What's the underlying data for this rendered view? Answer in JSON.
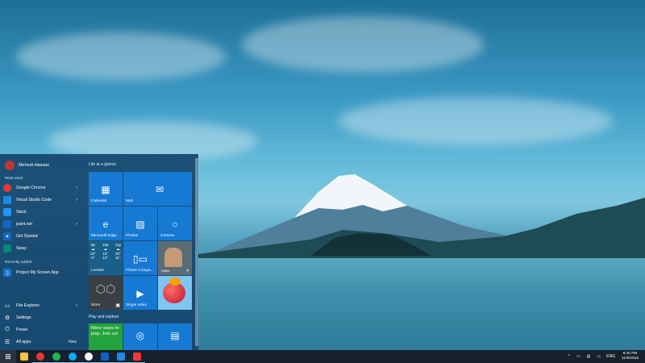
{
  "start_menu": {
    "user_name": "Mehedi Hassan",
    "most_used_label": "Most used",
    "most_used": [
      {
        "label": "Google Chrome",
        "icon": "chrome-icon",
        "color": "#e53935",
        "has_submenu": true
      },
      {
        "label": "Visual Studio Code",
        "icon": "vscode-icon",
        "color": "#1e88e5",
        "has_submenu": true
      },
      {
        "label": "Slack",
        "icon": "slack-icon",
        "color": "#2196f3",
        "has_submenu": false
      },
      {
        "label": "paint.net",
        "icon": "paintnet-icon",
        "color": "#1565c0",
        "has_submenu": true
      },
      {
        "label": "Get Started",
        "icon": "lightbulb-icon",
        "color": "#1565c0",
        "has_submenu": false
      },
      {
        "label": "Sway",
        "icon": "sway-icon",
        "color": "#00897b",
        "has_submenu": false
      }
    ],
    "recently_added_label": "Recently added",
    "recently_added": [
      {
        "label": "Project My Screen App",
        "icon": "project-screen-icon",
        "color": "#1976d2"
      }
    ],
    "system": {
      "file_explorer": "File Explorer",
      "settings": "Settings",
      "power": "Power",
      "all_apps": "All apps",
      "new_badge": "New"
    },
    "groups": {
      "life_at_a_glance": "Life at a glance",
      "play_and_explore": "Play and explore"
    },
    "tiles": {
      "calendar": "Calendar",
      "mail": "Mail",
      "edge": "Microsoft Edge",
      "photos": "Photos",
      "cortana": "Cortana",
      "weather_city": "London",
      "weather": [
        {
          "time": "9p",
          "temp": "15°",
          "low": "8°"
        },
        {
          "time": "10p",
          "temp": "16°",
          "low": "10°"
        },
        {
          "time": "11p",
          "temp": "20°",
          "low": "11°"
        }
      ],
      "phone_companion": "Phone Compa...",
      "twitter_name": "Twitter",
      "store": "Store",
      "skype_video": "Skype video",
      "xbox_promo": "More ways to play. Join us!"
    }
  },
  "taskbar": {
    "apps": [
      {
        "name": "file-explorer-taskbar-icon",
        "color": "#f9c440"
      },
      {
        "name": "chrome-taskbar-icon",
        "color": "#e53935"
      },
      {
        "name": "spotify-taskbar-icon",
        "color": "#1db954"
      },
      {
        "name": "skype-taskbar-icon",
        "color": "#00aff0"
      },
      {
        "name": "slack-taskbar-icon",
        "color": "#ffffff"
      },
      {
        "name": "outlook-taskbar-icon",
        "color": "#0a64c2"
      },
      {
        "name": "vscode-taskbar-icon",
        "color": "#1e88e5"
      },
      {
        "name": "vivaldi-taskbar-icon",
        "color": "#ef3939"
      }
    ],
    "language": "ENG",
    "time": "8:40 PM",
    "date": "11/8/2015"
  }
}
